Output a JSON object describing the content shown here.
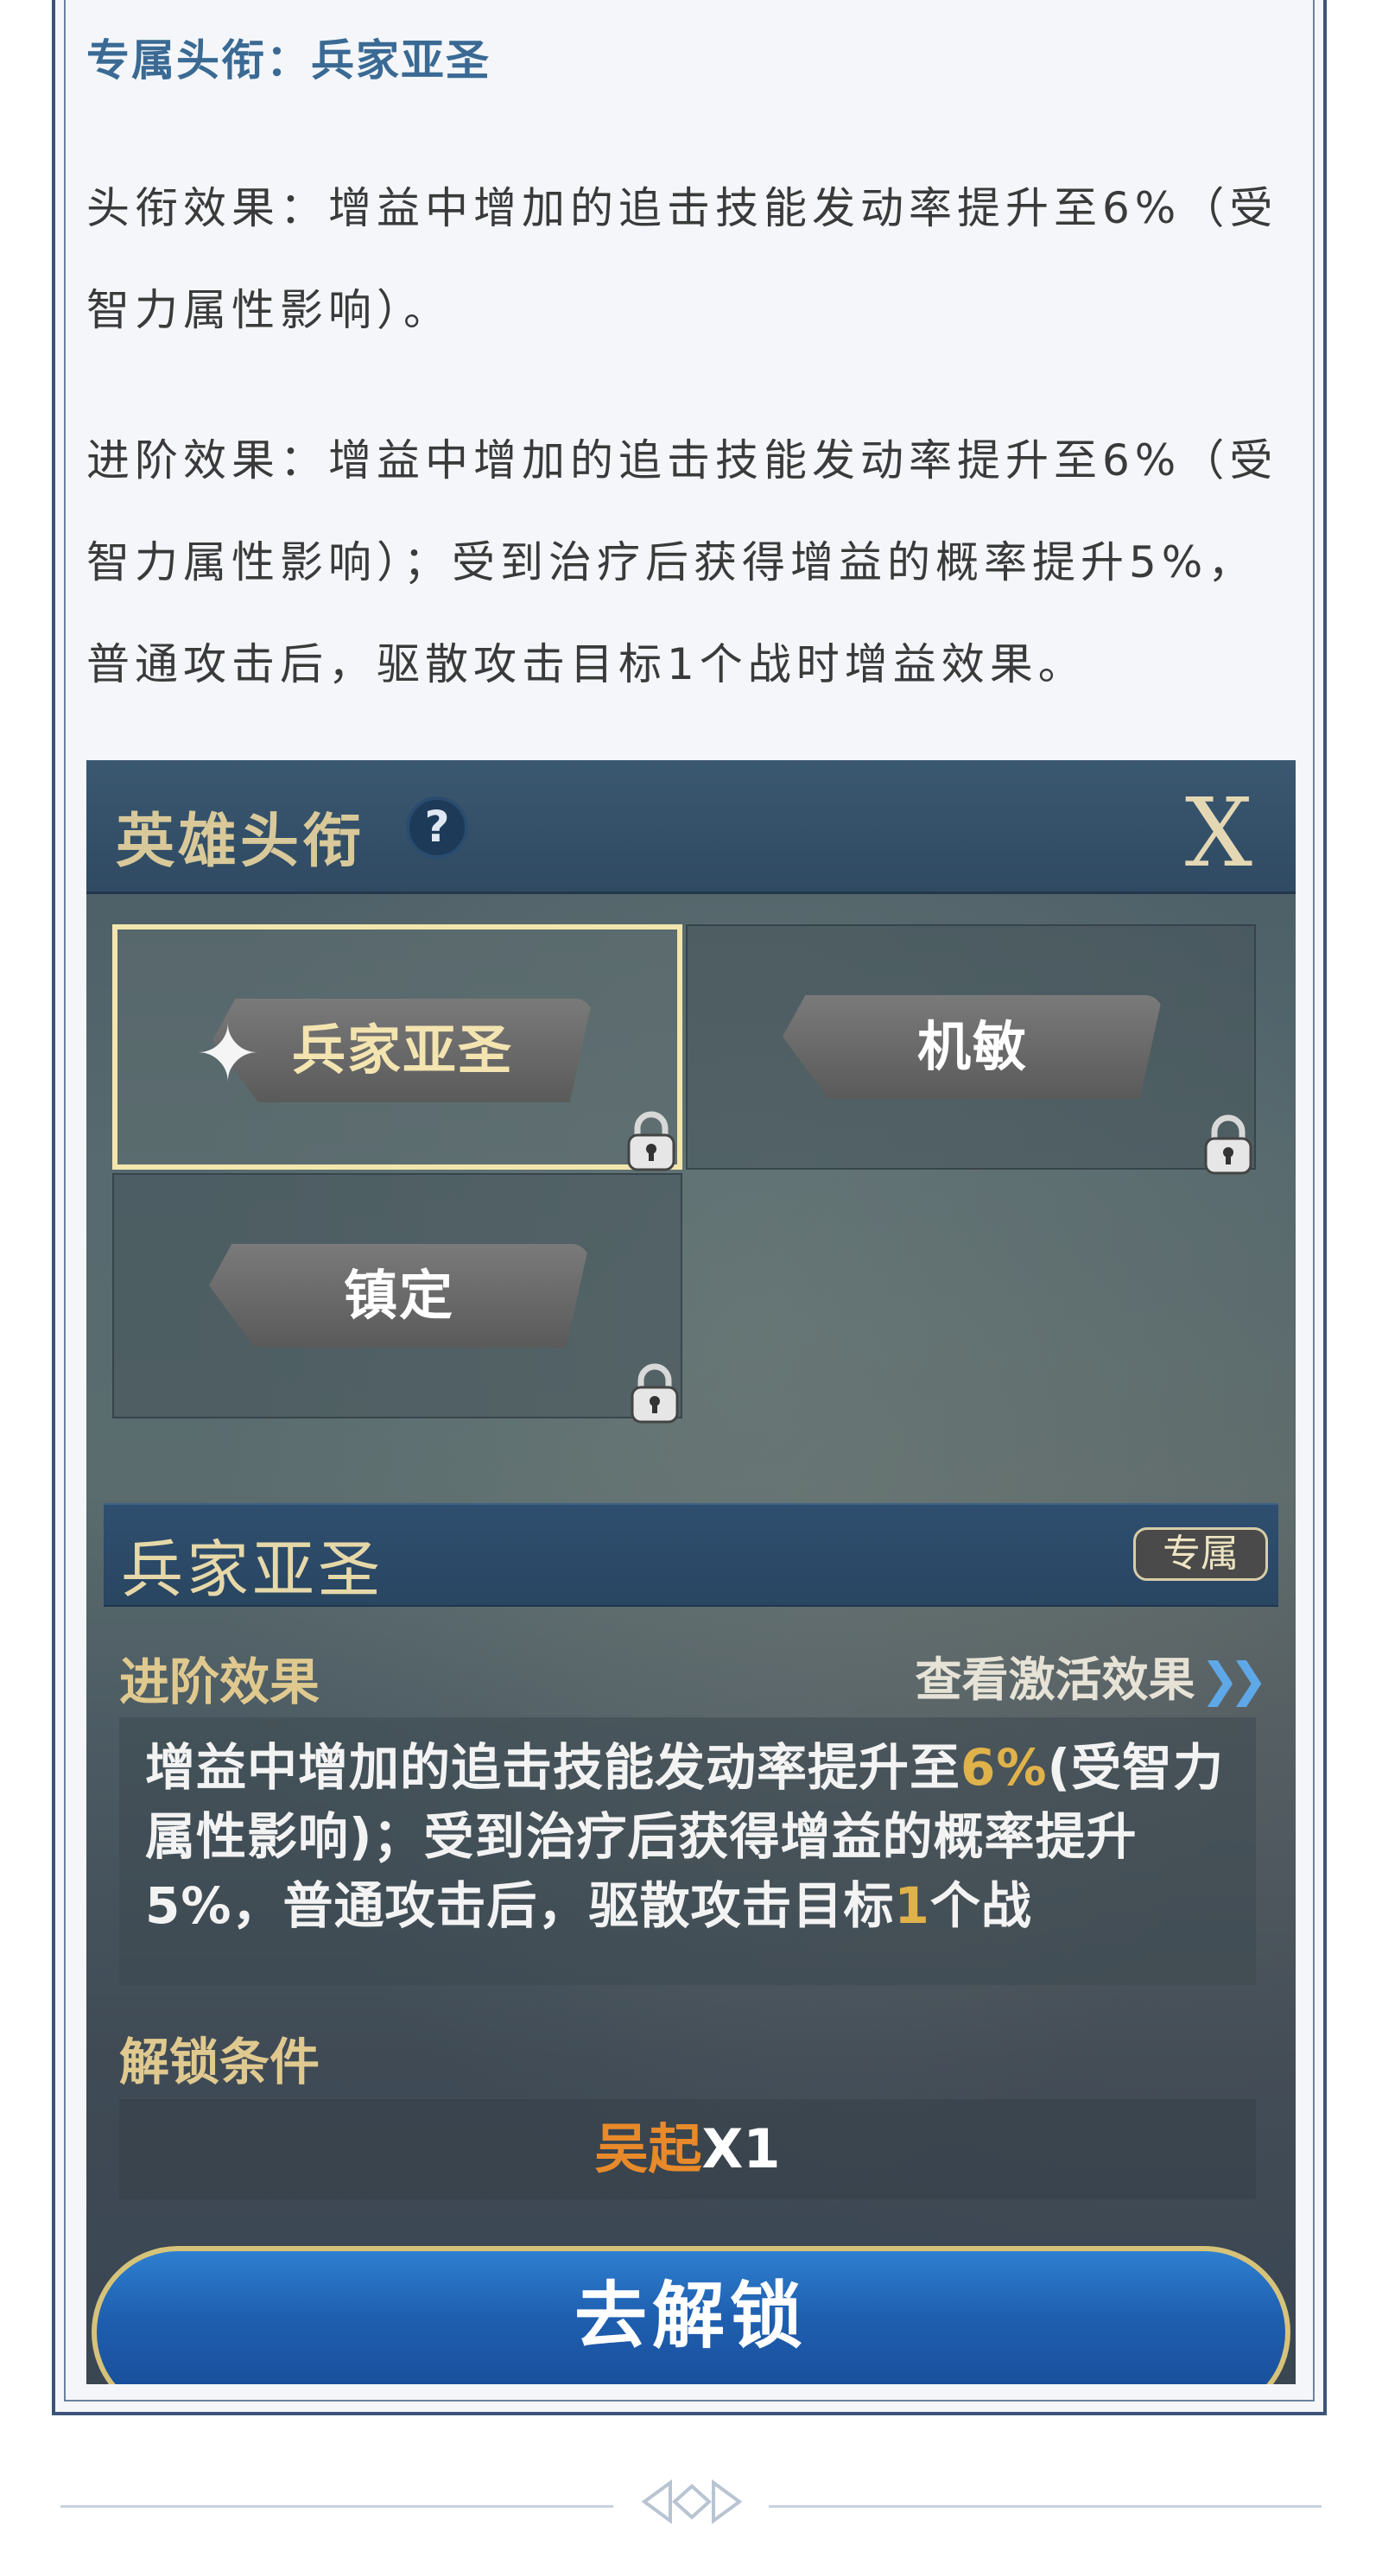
{
  "article": {
    "exclusive_title": "专属头衔：兵家亚圣",
    "para1": "头衔效果：增益中增加的追击技能发动率提升至6%（受智力属性影响）。",
    "para2": "进阶效果：增益中增加的追击技能发动率提升至6%（受智力属性影响）；受到治疗后获得增益的概率提升5%，普通攻击后，驱散攻击目标1个战时增益效果。"
  },
  "game": {
    "window_title": "英雄头衔",
    "help_label": "?",
    "close_label": "X",
    "titles": [
      {
        "label": "兵家亚圣",
        "selected": true,
        "locked": true
      },
      {
        "label": "机敏",
        "selected": false,
        "locked": true
      },
      {
        "label": "镇定",
        "selected": false,
        "locked": true
      }
    ],
    "detail": {
      "title": "兵家亚圣",
      "badge": "专属",
      "advanced_label": "进阶效果",
      "view_link": "查看激活效果",
      "effect_part1": "增益中增加的追击技能发动率提升至",
      "effect_hl1": "6%",
      "effect_part2": "(受智力属性影响)；受到治疗后获得增益的概率提升5%，普通攻击后，驱散攻击目标",
      "effect_hl2": "1",
      "effect_part3": "个战",
      "unlock_label": "解锁条件",
      "condition_name": "吴起",
      "condition_qty": "X1",
      "unlock_button": "去解锁"
    }
  },
  "colors": {
    "frame": "#3c5478",
    "title_blue": "#3a6a94",
    "gold": "#e0c98f",
    "highlight": "#e0b24a",
    "orange": "#e88a2a",
    "button_blue": "#1f5fb0"
  }
}
